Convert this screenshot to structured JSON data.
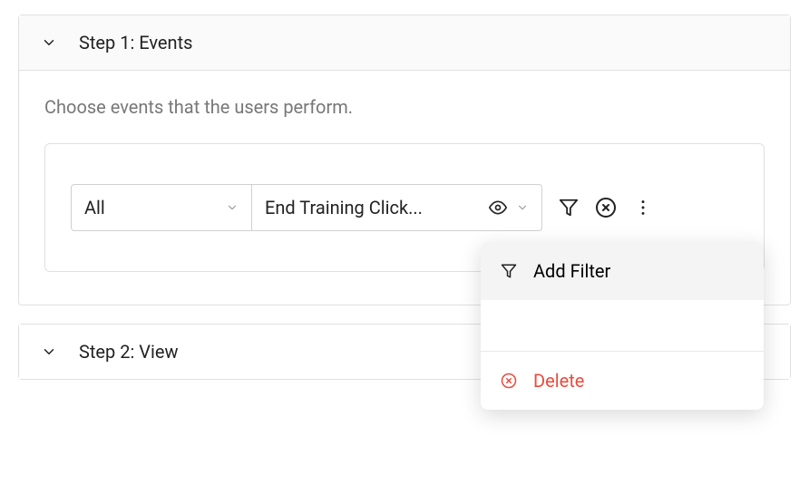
{
  "step1": {
    "title": "Step 1: Events",
    "description": "Choose events that the users perform.",
    "filter_select": "All",
    "event_select": "End Training Click..."
  },
  "step2": {
    "title": "Step 2: View"
  },
  "menu": {
    "add_filter": "Add Filter",
    "delete": "Delete"
  }
}
